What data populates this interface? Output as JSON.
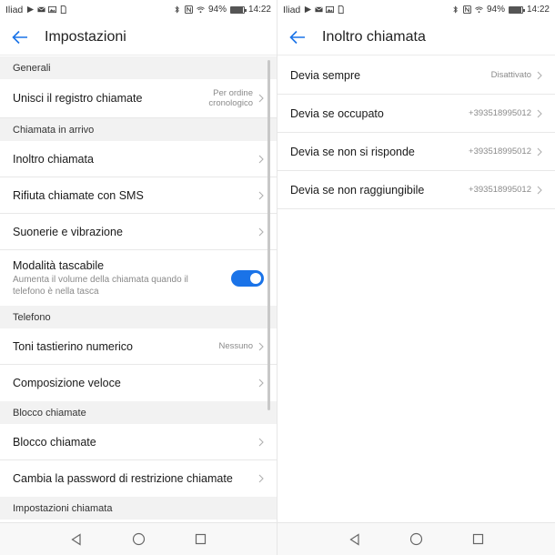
{
  "status_bar": {
    "carrier": "Iliad",
    "battery_percent": "94%",
    "battery_level": 0.94,
    "time": "14:22"
  },
  "left": {
    "title": "Impostazioni",
    "sections": [
      {
        "header": "Generali",
        "rows": [
          {
            "label": "Unisci il registro chiamate",
            "value_line1": "Per ordine",
            "value_line2": "cronologico"
          }
        ]
      },
      {
        "header": "Chiamata in arrivo",
        "rows": [
          {
            "label": "Inoltro chiamata"
          },
          {
            "label": "Rifiuta chiamate con SMS"
          },
          {
            "label": "Suonerie e vibrazione"
          }
        ],
        "toggle_row": {
          "label": "Modalità tascabile",
          "sub": "Aumenta il volume della chiamata quando il telefono è nella tasca",
          "on": true
        }
      },
      {
        "header": "Telefono",
        "rows": [
          {
            "label": "Toni tastierino numerico",
            "value": "Nessuno"
          },
          {
            "label": "Composizione veloce"
          }
        ]
      },
      {
        "header": "Blocco chiamate",
        "rows": [
          {
            "label": "Blocco chiamate"
          },
          {
            "label": "Cambia la password di restrizione chiamate"
          }
        ]
      },
      {
        "header": "Impostazioni chiamata"
      }
    ]
  },
  "right": {
    "title": "Inoltro chiamata",
    "rows": [
      {
        "label": "Devia sempre",
        "value": "Disattivato"
      },
      {
        "label": "Devia se occupato",
        "value": "+393518995012"
      },
      {
        "label": "Devia se non si risponde",
        "value": "+393518995012"
      },
      {
        "label": "Devia se non raggiungibile",
        "value": "+393518995012"
      }
    ]
  },
  "icons": {
    "back": "arrow-left-icon",
    "chevron": "chevron-right-icon",
    "nav_back": "triangle-back-icon",
    "nav_home": "circle-home-icon",
    "nav_recents": "square-recents-icon"
  },
  "colors": {
    "accent": "#1a73e8",
    "section_bg": "#f2f2f2",
    "secondary_text": "#8a8a8a"
  }
}
